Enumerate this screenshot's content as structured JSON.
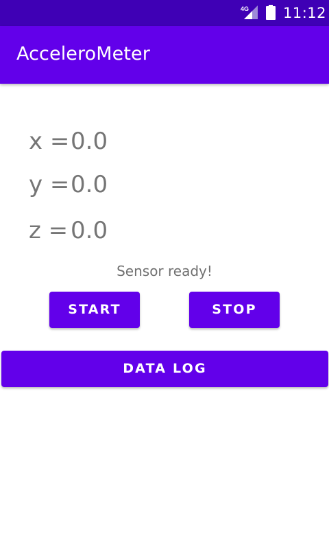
{
  "status_bar": {
    "network_label": "4G",
    "time": "11:12",
    "icons": [
      "signal-icon",
      "battery-icon"
    ],
    "background_color": "#3f00b5"
  },
  "app_bar": {
    "title": "AcceleroMeter",
    "background_color": "#6200ea"
  },
  "readings": [
    {
      "label": "x =",
      "value": "0.0"
    },
    {
      "label": "y =",
      "value": "0.0"
    },
    {
      "label": "z =",
      "value": "0.0"
    }
  ],
  "sensor_status": "Sensor ready!",
  "buttons": {
    "start": "START",
    "stop": "STOP",
    "data_log": "DATA LOG"
  },
  "colors": {
    "primary": "#6200ea",
    "reading_text": "#757575"
  }
}
